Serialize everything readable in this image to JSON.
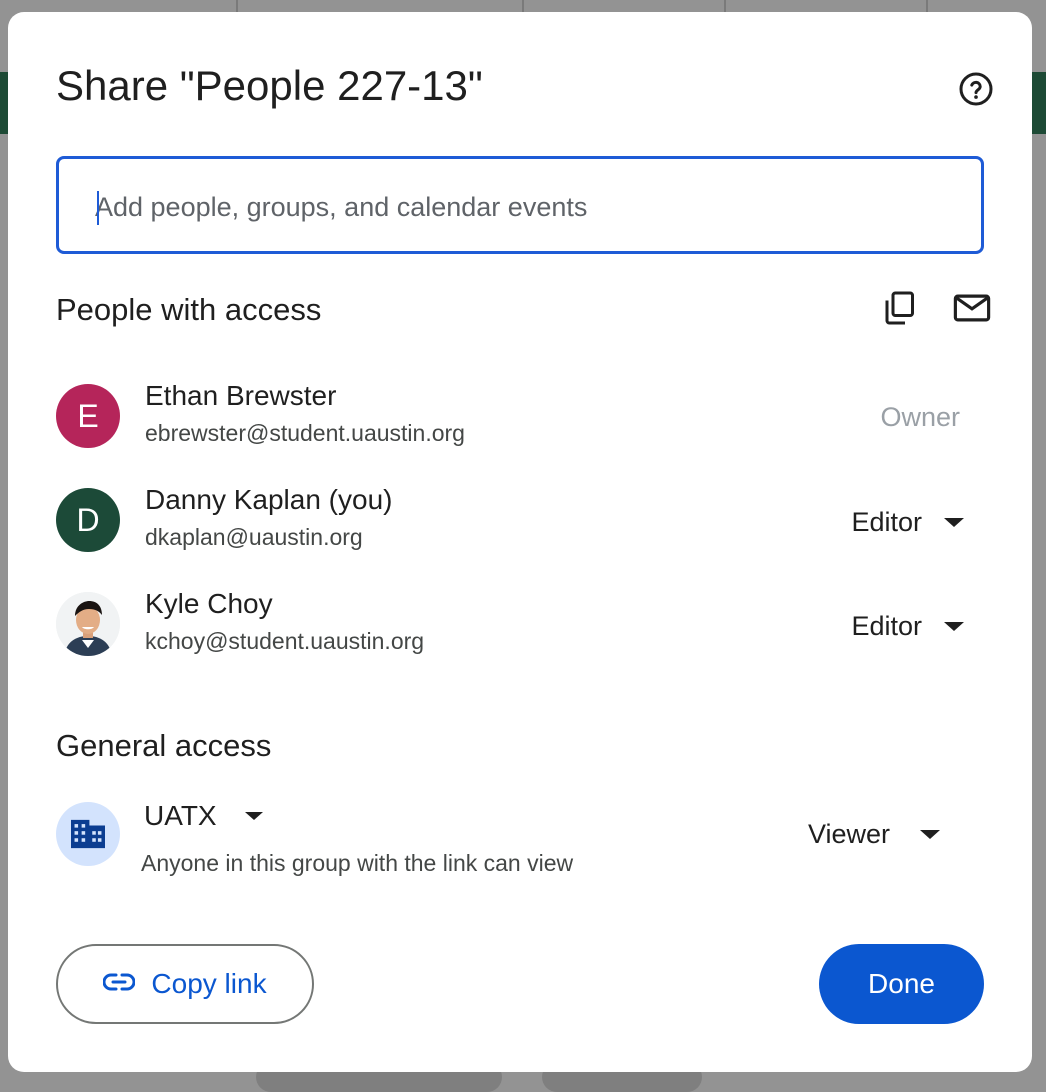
{
  "dialog": {
    "title": "Share \"People 227-13\"",
    "help_icon": "help-circle-icon"
  },
  "add_people": {
    "placeholder": "Add people, groups, and calendar events",
    "value": ""
  },
  "people_with_access": {
    "heading": "People with access",
    "copy_icon": "copy-icon",
    "email_icon": "mail-icon",
    "people": [
      {
        "initial": "E",
        "name": "Ethan Brewster",
        "email": "ebrewster@student.uaustin.org",
        "role": "Owner",
        "avatar_color": "#b5255a"
      },
      {
        "initial": "D",
        "name": "Danny Kaplan (you)",
        "email": "dkaplan@uaustin.org",
        "role": "Editor",
        "avatar_color": "#1c4a38"
      },
      {
        "initial": "",
        "name": "Kyle Choy",
        "email": "kchoy@student.uaustin.org",
        "role": "Editor",
        "avatar_type": "photo"
      }
    ]
  },
  "general_access": {
    "heading": "General access",
    "group": "UATX",
    "description": "Anyone in this group with the link can view",
    "role": "Viewer",
    "icon": "domain-building-icon"
  },
  "footer": {
    "copy_link_label": "Copy link",
    "copy_link_icon": "link-icon",
    "done_label": "Done"
  },
  "colors": {
    "accent": "#0b57d0",
    "focus_border": "#1e5bd6",
    "owner_text": "#9aa0a6"
  }
}
